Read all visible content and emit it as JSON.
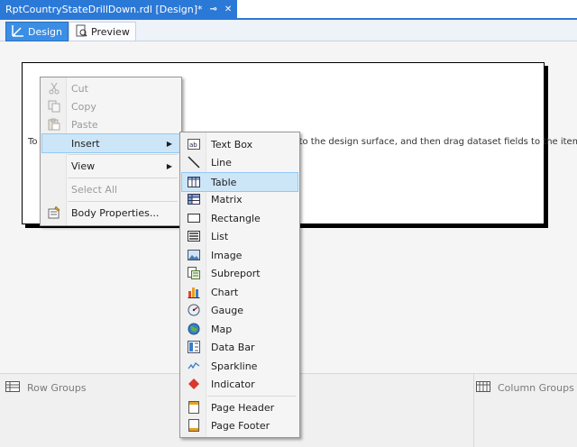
{
  "document_tab": {
    "title": "RptCountryStateDrillDown.rdl [Design]*",
    "pin": "⊸",
    "close": "✕"
  },
  "view_tabs": {
    "design": "Design",
    "preview": "Preview"
  },
  "design_surface": {
    "hint_text": "To add an item to the report, drag an item from the toolbox to the design surface, and then drag dataset fields to the item."
  },
  "context_menu": {
    "items": [
      {
        "label": "Cut",
        "icon": "scissors-icon",
        "disabled": true
      },
      {
        "label": "Copy",
        "icon": "copy-icon",
        "disabled": true
      },
      {
        "label": "Paste",
        "icon": "paste-icon",
        "disabled": true
      },
      {
        "label": "Insert",
        "icon": "",
        "highlighted": true,
        "submenu": true
      },
      {
        "label": "View",
        "icon": "",
        "submenu": true
      },
      {
        "label": "Select All",
        "icon": "",
        "disabled": true
      },
      {
        "label": "Body Properties...",
        "icon": "properties-icon"
      }
    ]
  },
  "insert_submenu": {
    "items": [
      {
        "label": "Text Box",
        "icon": "textbox-icon"
      },
      {
        "label": "Line",
        "icon": "line-icon"
      },
      {
        "label": "Table",
        "icon": "table-icon",
        "highlighted": true
      },
      {
        "label": "Matrix",
        "icon": "matrix-icon"
      },
      {
        "label": "Rectangle",
        "icon": "rectangle-icon"
      },
      {
        "label": "List",
        "icon": "list-icon"
      },
      {
        "label": "Image",
        "icon": "image-icon"
      },
      {
        "label": "Subreport",
        "icon": "subreport-icon"
      },
      {
        "label": "Chart",
        "icon": "chart-icon"
      },
      {
        "label": "Gauge",
        "icon": "gauge-icon"
      },
      {
        "label": "Map",
        "icon": "map-icon"
      },
      {
        "label": "Data Bar",
        "icon": "databar-icon"
      },
      {
        "label": "Sparkline",
        "icon": "sparkline-icon"
      },
      {
        "label": "Indicator",
        "icon": "indicator-icon"
      },
      {
        "label": "Page Header",
        "icon": "page-header-icon"
      },
      {
        "label": "Page Footer",
        "icon": "page-footer-icon"
      }
    ]
  },
  "grouping_pane": {
    "row_groups": "Row Groups",
    "column_groups": "Column Groups"
  },
  "colors": {
    "accent": "#2b79d7",
    "highlight": "#cde6f7",
    "indicator": "#d9382b"
  }
}
